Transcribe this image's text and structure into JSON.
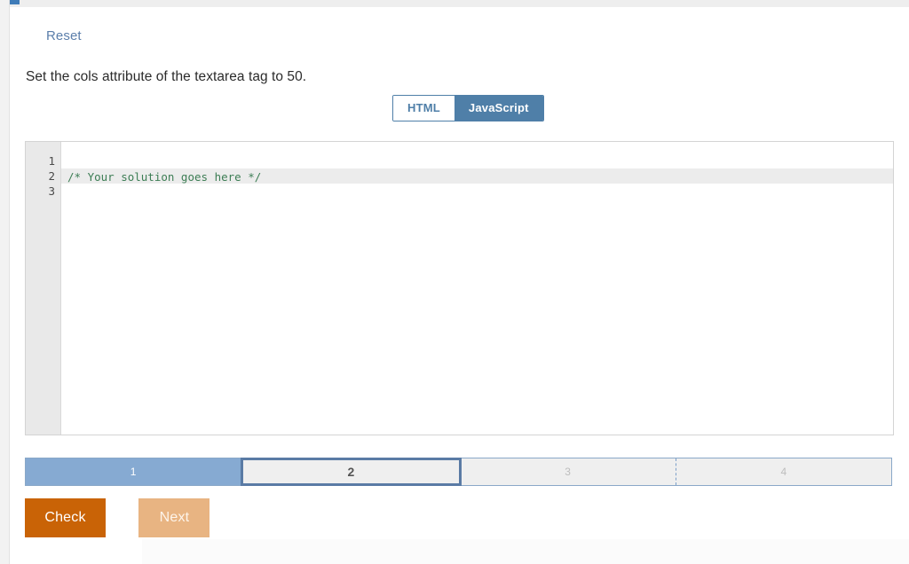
{
  "window": {
    "background": "#ffffff",
    "accent_blue": "#4f7fa8",
    "accent_orange": "#c96306"
  },
  "toolbar": {
    "reset_label": "Reset"
  },
  "task": {
    "instruction": "Set the cols attribute of the textarea tag to 50."
  },
  "language_toggle": {
    "options": [
      {
        "label": "HTML",
        "active": false
      },
      {
        "label": "JavaScript",
        "active": true
      }
    ],
    "selected": "JavaScript"
  },
  "editor": {
    "language": "JavaScript",
    "gutter": [
      "1",
      "2",
      "3"
    ],
    "active_line": 2,
    "lines": [
      {
        "number": "1",
        "text": ""
      },
      {
        "number": "2",
        "text": "/* Your solution goes here */"
      },
      {
        "number": "3",
        "text": ""
      }
    ]
  },
  "steps": {
    "items": [
      {
        "label": "1",
        "state": "done"
      },
      {
        "label": "2",
        "state": "current"
      },
      {
        "label": "3",
        "state": "todo"
      },
      {
        "label": "4",
        "state": "todo"
      }
    ]
  },
  "buttons": {
    "check_label": "Check",
    "next_label": "Next"
  }
}
